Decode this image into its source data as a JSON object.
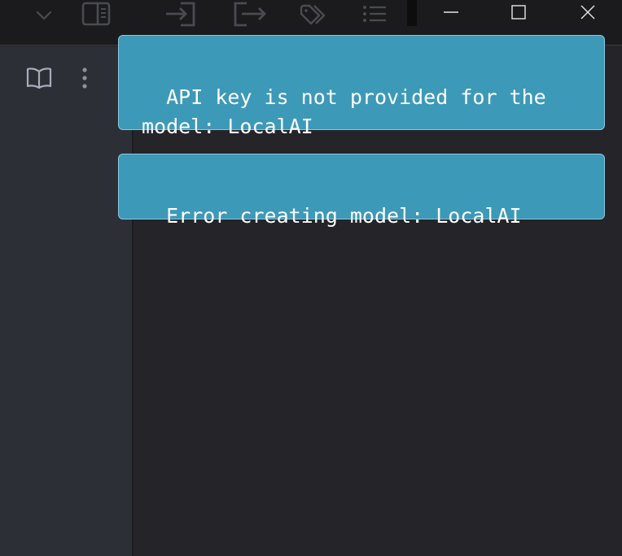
{
  "toolbar": {
    "icons": [
      "chevron-down-icon",
      "sidebar-panel-icon",
      "import-icon",
      "export-icon",
      "tags-icon",
      "list-icon"
    ]
  },
  "window_controls": {
    "icons": [
      "minimize-icon",
      "maximize-icon",
      "close-icon"
    ]
  },
  "sidebar": {
    "icons": [
      "book-icon",
      "more-vertical-icon"
    ]
  },
  "notices": [
    {
      "text": "API key is not provided for the model: LocalAI"
    },
    {
      "text": "Error creating model: LocalAI"
    }
  ],
  "colors": {
    "notice_bg": "#3d99b8",
    "notice_border": "#8ec7db",
    "sidebar_bg": "#2d2f37",
    "main_bg": "#242429",
    "topbar_bg": "#1b1b1d"
  }
}
